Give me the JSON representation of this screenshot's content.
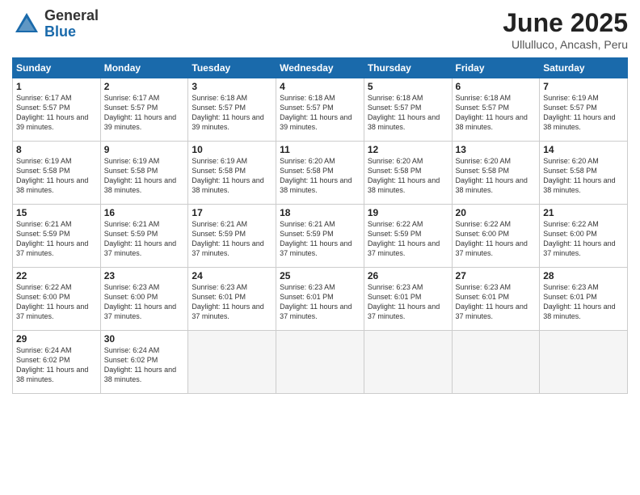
{
  "logo": {
    "general": "General",
    "blue": "Blue"
  },
  "title": "June 2025",
  "location": "Ullulluco, Ancash, Peru",
  "days_of_week": [
    "Sunday",
    "Monday",
    "Tuesday",
    "Wednesday",
    "Thursday",
    "Friday",
    "Saturday"
  ],
  "weeks": [
    [
      {
        "day": 1,
        "sunrise": "6:17 AM",
        "sunset": "5:57 PM",
        "daylight": "11 hours and 39 minutes."
      },
      {
        "day": 2,
        "sunrise": "6:17 AM",
        "sunset": "5:57 PM",
        "daylight": "11 hours and 39 minutes."
      },
      {
        "day": 3,
        "sunrise": "6:18 AM",
        "sunset": "5:57 PM",
        "daylight": "11 hours and 39 minutes."
      },
      {
        "day": 4,
        "sunrise": "6:18 AM",
        "sunset": "5:57 PM",
        "daylight": "11 hours and 39 minutes."
      },
      {
        "day": 5,
        "sunrise": "6:18 AM",
        "sunset": "5:57 PM",
        "daylight": "11 hours and 38 minutes."
      },
      {
        "day": 6,
        "sunrise": "6:18 AM",
        "sunset": "5:57 PM",
        "daylight": "11 hours and 38 minutes."
      },
      {
        "day": 7,
        "sunrise": "6:19 AM",
        "sunset": "5:57 PM",
        "daylight": "11 hours and 38 minutes."
      }
    ],
    [
      {
        "day": 8,
        "sunrise": "6:19 AM",
        "sunset": "5:58 PM",
        "daylight": "11 hours and 38 minutes."
      },
      {
        "day": 9,
        "sunrise": "6:19 AM",
        "sunset": "5:58 PM",
        "daylight": "11 hours and 38 minutes."
      },
      {
        "day": 10,
        "sunrise": "6:19 AM",
        "sunset": "5:58 PM",
        "daylight": "11 hours and 38 minutes."
      },
      {
        "day": 11,
        "sunrise": "6:20 AM",
        "sunset": "5:58 PM",
        "daylight": "11 hours and 38 minutes."
      },
      {
        "day": 12,
        "sunrise": "6:20 AM",
        "sunset": "5:58 PM",
        "daylight": "11 hours and 38 minutes."
      },
      {
        "day": 13,
        "sunrise": "6:20 AM",
        "sunset": "5:58 PM",
        "daylight": "11 hours and 38 minutes."
      },
      {
        "day": 14,
        "sunrise": "6:20 AM",
        "sunset": "5:58 PM",
        "daylight": "11 hours and 38 minutes."
      }
    ],
    [
      {
        "day": 15,
        "sunrise": "6:21 AM",
        "sunset": "5:59 PM",
        "daylight": "11 hours and 37 minutes."
      },
      {
        "day": 16,
        "sunrise": "6:21 AM",
        "sunset": "5:59 PM",
        "daylight": "11 hours and 37 minutes."
      },
      {
        "day": 17,
        "sunrise": "6:21 AM",
        "sunset": "5:59 PM",
        "daylight": "11 hours and 37 minutes."
      },
      {
        "day": 18,
        "sunrise": "6:21 AM",
        "sunset": "5:59 PM",
        "daylight": "11 hours and 37 minutes."
      },
      {
        "day": 19,
        "sunrise": "6:22 AM",
        "sunset": "5:59 PM",
        "daylight": "11 hours and 37 minutes."
      },
      {
        "day": 20,
        "sunrise": "6:22 AM",
        "sunset": "6:00 PM",
        "daylight": "11 hours and 37 minutes."
      },
      {
        "day": 21,
        "sunrise": "6:22 AM",
        "sunset": "6:00 PM",
        "daylight": "11 hours and 37 minutes."
      }
    ],
    [
      {
        "day": 22,
        "sunrise": "6:22 AM",
        "sunset": "6:00 PM",
        "daylight": "11 hours and 37 minutes."
      },
      {
        "day": 23,
        "sunrise": "6:23 AM",
        "sunset": "6:00 PM",
        "daylight": "11 hours and 37 minutes."
      },
      {
        "day": 24,
        "sunrise": "6:23 AM",
        "sunset": "6:01 PM",
        "daylight": "11 hours and 37 minutes."
      },
      {
        "day": 25,
        "sunrise": "6:23 AM",
        "sunset": "6:01 PM",
        "daylight": "11 hours and 37 minutes."
      },
      {
        "day": 26,
        "sunrise": "6:23 AM",
        "sunset": "6:01 PM",
        "daylight": "11 hours and 37 minutes."
      },
      {
        "day": 27,
        "sunrise": "6:23 AM",
        "sunset": "6:01 PM",
        "daylight": "11 hours and 37 minutes."
      },
      {
        "day": 28,
        "sunrise": "6:23 AM",
        "sunset": "6:01 PM",
        "daylight": "11 hours and 38 minutes."
      }
    ],
    [
      {
        "day": 29,
        "sunrise": "6:24 AM",
        "sunset": "6:02 PM",
        "daylight": "11 hours and 38 minutes."
      },
      {
        "day": 30,
        "sunrise": "6:24 AM",
        "sunset": "6:02 PM",
        "daylight": "11 hours and 38 minutes."
      },
      null,
      null,
      null,
      null,
      null
    ]
  ]
}
